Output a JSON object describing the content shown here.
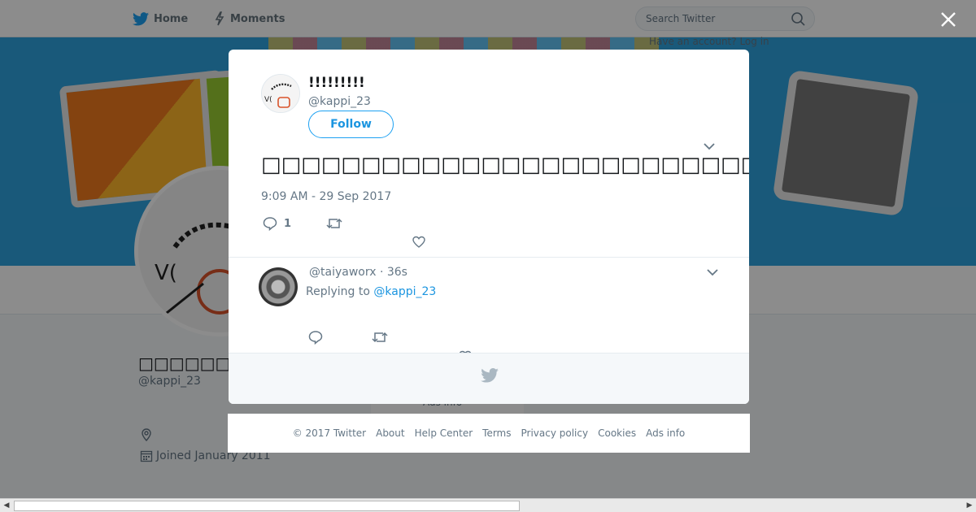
{
  "nav": {
    "home_label": "Home",
    "moments_label": "Moments",
    "search_placeholder": "Search Twitter",
    "have_account": "Have an account? Log in"
  },
  "profile": {
    "name": "□□□□□□□!!!",
    "handle": "@kappi_23",
    "joined": "Joined January 2011",
    "ads_info_bg": "Ads info"
  },
  "tweet": {
    "author_name": "!!!!!!!!!",
    "author_handle": "@kappi_23",
    "follow_label": "Follow",
    "text": "□□□□□□□□□□□□□□□□□□□□□□□□□□□□□□□□□□□□□□□□□□□□□□□□□□□□□□□□□□□□□□",
    "timestamp": "9:09 AM - 29 Sep 2017",
    "reply_count": "1"
  },
  "reply": {
    "handle_time": "@taiyaworx · 36s",
    "replying_prefix": "Replying to",
    "replying_to": "@kappi_23"
  },
  "footer": {
    "copyright": "© 2017 Twitter",
    "about": "About",
    "help_center": "Help Center",
    "terms": "Terms",
    "privacy": "Privacy policy",
    "cookies": "Cookies",
    "ads_info": "Ads info"
  },
  "colors": {
    "accent": "#1da1f2",
    "link": "#1b95e0",
    "muted": "#657786",
    "banner": "#2fa3df"
  },
  "icons": [
    "twitter-bird-icon",
    "moments-bolt-icon",
    "search-icon",
    "close-icon",
    "chevron-down-icon",
    "reply-icon",
    "retweet-icon",
    "heart-icon",
    "location-icon",
    "calendar-icon"
  ]
}
